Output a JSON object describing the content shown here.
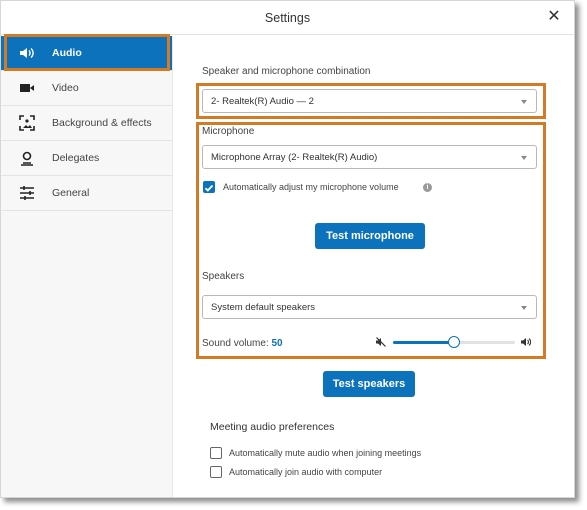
{
  "window": {
    "title": "Settings",
    "close_icon": "close-icon"
  },
  "sidebar": {
    "items": [
      {
        "label": "Audio",
        "icon": "speaker-icon",
        "active": true
      },
      {
        "label": "Video",
        "icon": "video-camera-icon",
        "active": false
      },
      {
        "label": "Background & effects",
        "icon": "background-icon",
        "active": false
      },
      {
        "label": "Delegates",
        "icon": "delegate-icon",
        "active": false
      },
      {
        "label": "General",
        "icon": "sliders-icon",
        "active": false
      }
    ]
  },
  "audio": {
    "combo_label": "Speaker and microphone combination",
    "combo_value": "2- Realtek(R) Audio — 2",
    "microphone_label": "Microphone",
    "microphone_value": "Microphone Array (2- Realtek(R) Audio)",
    "auto_adjust_label": "Automatically adjust my microphone volume",
    "auto_adjust_checked": true,
    "info_glyph": "i",
    "test_microphone": "Test microphone",
    "speakers_label": "Speakers",
    "speakers_value": "System default speakers",
    "volume_label": "Sound volume:",
    "volume_value": "50",
    "volume_percent": 50,
    "test_speakers": "Test speakers",
    "preferences_title": "Meeting audio preferences",
    "preferences": [
      {
        "label": "Automatically mute audio when joining meetings",
        "checked": false
      },
      {
        "label": "Automatically join audio with computer",
        "checked": false
      }
    ]
  },
  "colors": {
    "accent": "#0c72bb",
    "highlight": "#d37a25"
  }
}
